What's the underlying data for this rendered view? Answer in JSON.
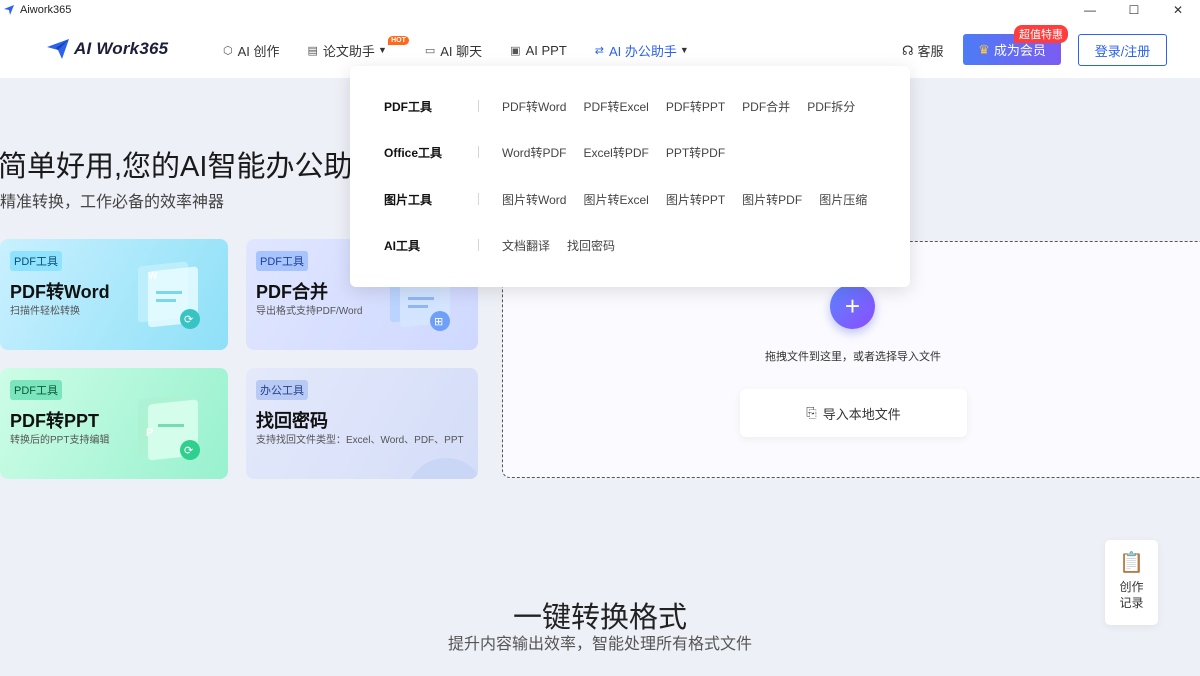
{
  "window": {
    "title": "Aiwork365",
    "controls": [
      "—",
      "☐",
      "✕"
    ]
  },
  "header": {
    "logo_text": "AI Work365",
    "nav": [
      {
        "label": "AI 创作",
        "icon": "cube-icon"
      },
      {
        "label": "论文助手",
        "icon": "doc-icon",
        "badge": "HOT"
      },
      {
        "label": "AI 聊天",
        "icon": "chat-icon"
      },
      {
        "label": "AI PPT",
        "icon": "ppt-icon"
      },
      {
        "label": "AI 办公助手",
        "icon": "swap-icon",
        "active": true
      }
    ],
    "support": "客服",
    "vip_button": "成为会员",
    "vip_badge": "超值特惠",
    "login": "登录/注册"
  },
  "hero": {
    "title": "简单好用,您的AI智能办公助",
    "subtitle": "精准转换，工作必备的效率神器"
  },
  "cards": [
    {
      "tag": "PDF工具",
      "title": "PDF转Word",
      "desc": "扫描件轻松转换"
    },
    {
      "tag": "PDF工具",
      "title": "PDF合并",
      "desc": "导出格式支持PDF/Word"
    },
    {
      "tag": "PDF工具",
      "title": "PDF转PPT",
      "desc": "转换后的PPT支持编辑"
    },
    {
      "tag": "办公工具",
      "title": "找回密码",
      "desc": "支持找回文件类型：Excel、Word、PDF、PPT"
    }
  ],
  "upload": {
    "hint": "拖拽文件到这里，或者选择导入文件",
    "button": "导入本地文件"
  },
  "dropdown": [
    {
      "group": "PDF工具",
      "items": [
        "PDF转Word",
        "PDF转Excel",
        "PDF转PPT",
        "PDF合并",
        "PDF拆分"
      ]
    },
    {
      "group": "Office工具",
      "items": [
        "Word转PDF",
        "Excel转PDF",
        "PPT转PDF"
      ]
    },
    {
      "group": "图片工具",
      "items": [
        "图片转Word",
        "图片转Excel",
        "图片转PPT",
        "图片转PDF",
        "图片压缩"
      ]
    },
    {
      "group": "AI工具",
      "items": [
        "文档翻译",
        "找回密码"
      ]
    }
  ],
  "record_button": "创作记录",
  "section": {
    "title": "一键转换格式",
    "subtitle": "提升内容输出效率，智能处理所有格式文件"
  }
}
